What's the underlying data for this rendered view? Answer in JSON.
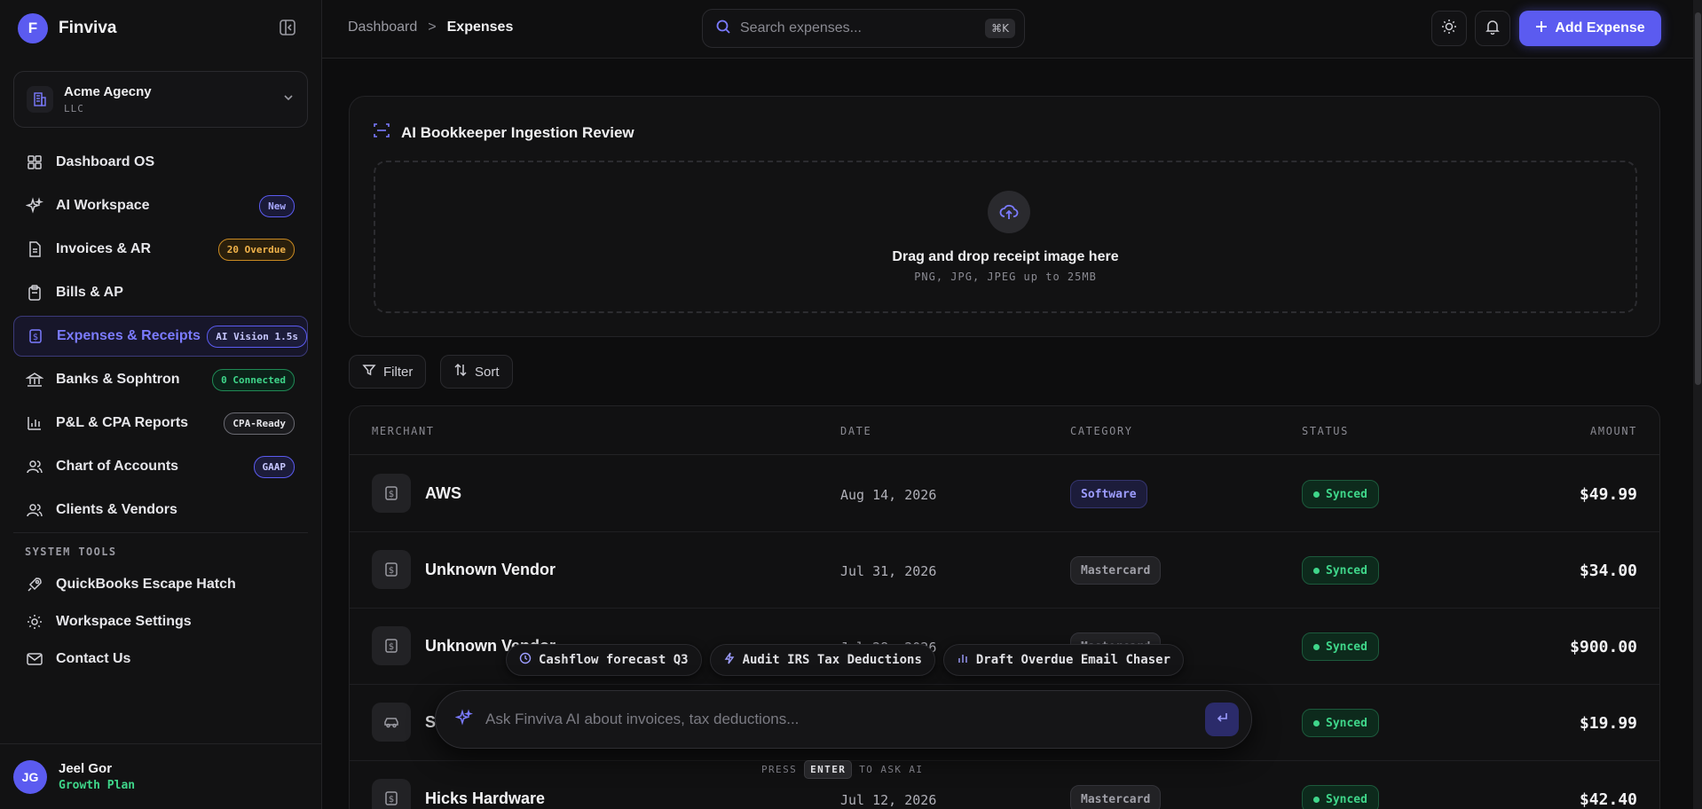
{
  "brand": {
    "initial": "F",
    "name": "Finviva"
  },
  "org": {
    "name": "Acme Agecny",
    "sub": "LLC"
  },
  "nav": [
    {
      "label": "Dashboard OS",
      "icon": "grid-icon"
    },
    {
      "label": "AI Workspace",
      "icon": "sparkles-icon",
      "badge": "New"
    },
    {
      "label": "Invoices & AR",
      "icon": "document-icon",
      "badge": "20 Overdue"
    },
    {
      "label": "Bills & AP",
      "icon": "clipboard-icon"
    },
    {
      "label": "Expenses & Receipts",
      "icon": "receipt-icon",
      "badge": "AI Vision 1.5s",
      "active": true
    },
    {
      "label": "Banks & Sophtron",
      "icon": "bank-icon",
      "badge": "0 Connected"
    },
    {
      "label": "P&L & CPA Reports",
      "icon": "bar-chart-icon",
      "badge": "CPA-Ready"
    },
    {
      "label": "Chart of Accounts",
      "icon": "users-icon",
      "badge": "GAAP"
    },
    {
      "label": "Clients & Vendors",
      "icon": "user-group-icon"
    }
  ],
  "system_tools": {
    "title": "SYSTEM TOOLS",
    "items": [
      {
        "label": "QuickBooks Escape Hatch",
        "icon": "rocket-icon"
      },
      {
        "label": "Workspace Settings",
        "icon": "gear-icon"
      },
      {
        "label": "Contact Us",
        "icon": "mail-icon"
      }
    ]
  },
  "user": {
    "initials": "JG",
    "name": "Jeel Gor",
    "plan": "Growth Plan"
  },
  "breadcrumb": {
    "parent": "Dashboard",
    "separator": ">",
    "current": "Expenses"
  },
  "search": {
    "placeholder": "Search expenses...",
    "shortcut": "⌘K"
  },
  "add_button": "Add Expense",
  "upload": {
    "title": "AI Bookkeeper Ingestion Review",
    "drop_title": "Drag and drop receipt image here",
    "drop_sub": "PNG, JPG, JPEG up to 25MB"
  },
  "controls": {
    "filter": "Filter",
    "sort": "Sort"
  },
  "table": {
    "columns": [
      "MERCHANT",
      "DATE",
      "CATEGORY",
      "STATUS",
      "AMOUNT"
    ],
    "rows": [
      {
        "merchant": "AWS",
        "date": "Aug 14, 2026",
        "category": "Software",
        "status": "Synced",
        "amount": "$49.99",
        "icon": "receipt-icon"
      },
      {
        "merchant": "Unknown Vendor",
        "date": "Jul 31, 2026",
        "category": "Mastercard",
        "status": "Synced",
        "amount": "$34.00",
        "icon": "receipt-icon"
      },
      {
        "merchant": "Unknown Vendor",
        "date": "Jul 28, 2026",
        "category": "Mastercard",
        "status": "Synced",
        "amount": "$900.00",
        "icon": "receipt-icon"
      },
      {
        "merchant": "S",
        "date": "",
        "category": "",
        "status": "Synced",
        "amount": "$19.99",
        "icon": "car-icon"
      },
      {
        "merchant": "Hicks Hardware",
        "date": "Jul 12, 2026",
        "category": "Mastercard",
        "status": "Synced",
        "amount": "$42.40",
        "icon": "receipt-icon"
      }
    ]
  },
  "ai": {
    "chips": [
      {
        "label": "Cashflow forecast Q3",
        "icon": "clock-icon"
      },
      {
        "label": "Audit IRS Tax Deductions",
        "icon": "lightning-icon"
      },
      {
        "label": "Draft Overdue Email Chaser",
        "icon": "bar-chart-icon"
      }
    ],
    "placeholder": "Ask Finviva AI about invoices, tax deductions...",
    "hint_pre": "PRESS",
    "hint_key": "ENTER",
    "hint_post": "TO ASK AI"
  },
  "colors": {
    "accent": "#5b5bf0",
    "success": "#3fd68a",
    "warning": "#f0b24a",
    "background": "#0d0d0e"
  }
}
